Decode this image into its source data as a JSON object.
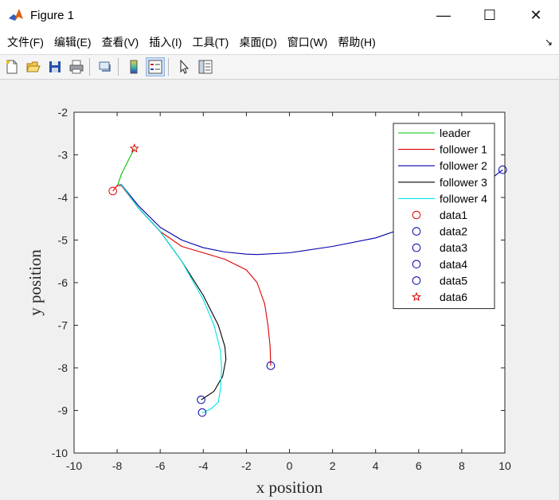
{
  "window": {
    "title": "Figure 1",
    "controls": {
      "minimize": "—",
      "maximize": "☐",
      "close": "✕"
    }
  },
  "menu": {
    "items": [
      "文件(F)",
      "编辑(E)",
      "查看(V)",
      "插入(I)",
      "工具(T)",
      "桌面(D)",
      "窗口(W)",
      "帮助(H)"
    ],
    "more_icon": "↘"
  },
  "toolbar": {
    "buttons": [
      "new-figure-icon",
      "open-file-icon",
      "save-icon",
      "print-icon",
      "link-plot-icon",
      "colorbar-icon",
      "legend-icon",
      "pointer-icon",
      "property-inspector-icon"
    ]
  },
  "chart_data": {
    "type": "line",
    "title": "",
    "xlabel": "x position",
    "ylabel": "y position",
    "xlim": [
      -10,
      10
    ],
    "ylim": [
      -10,
      -2
    ],
    "xticks": [
      -10,
      -8,
      -6,
      -4,
      -2,
      0,
      2,
      4,
      6,
      8,
      10
    ],
    "yticks": [
      -2,
      -3,
      -4,
      -5,
      -6,
      -7,
      -8,
      -9,
      -10
    ],
    "legend_position": "top-right",
    "grid": false,
    "series": [
      {
        "name": "leader",
        "kind": "line",
        "color": "#00c000",
        "x": [
          -7.2,
          -7.5,
          -7.8,
          -8.0
        ],
        "y": [
          -2.85,
          -3.15,
          -3.45,
          -3.75
        ]
      },
      {
        "name": "follower 1",
        "kind": "line",
        "color": "#dd0000",
        "x": [
          -8.2,
          -8.0,
          -7.8,
          -7.0,
          -6.0,
          -5.0,
          -4.0,
          -3.0,
          -2.0,
          -1.5,
          -1.15,
          -1.0,
          -0.9,
          -0.88,
          -0.87
        ],
        "y": [
          -3.85,
          -3.72,
          -3.72,
          -4.25,
          -4.8,
          -5.15,
          -5.3,
          -5.45,
          -5.7,
          -6.0,
          -6.5,
          -7.0,
          -7.5,
          -7.8,
          -7.95
        ]
      },
      {
        "name": "follower 2",
        "kind": "line",
        "color": "#0000aa",
        "x": [
          -7.9,
          -7.8,
          -7.0,
          -6.0,
          -5.0,
          -4.0,
          -3.0,
          -2.0,
          -1.5,
          0.0,
          2.0,
          4.0,
          6.0,
          8.0,
          9.9
        ],
        "y": [
          -3.7,
          -3.7,
          -4.2,
          -4.7,
          -5.0,
          -5.18,
          -5.28,
          -5.33,
          -5.34,
          -5.3,
          -5.15,
          -4.95,
          -4.6,
          -4.1,
          -3.35
        ]
      },
      {
        "name": "follower 3",
        "kind": "line",
        "color": "#000000",
        "x": [
          -7.9,
          -7.8,
          -7.0,
          -6.0,
          -5.0,
          -4.0,
          -3.3,
          -3.0,
          -2.95,
          -3.1,
          -3.5,
          -4.0,
          -4.1
        ],
        "y": [
          -3.7,
          -3.7,
          -4.25,
          -4.8,
          -5.5,
          -6.3,
          -7.0,
          -7.5,
          -7.8,
          -8.2,
          -8.55,
          -8.72,
          -8.75
        ]
      },
      {
        "name": "follower 4",
        "kind": "line",
        "color": "#00e5e5",
        "x": [
          -7.9,
          -7.8,
          -7.0,
          -6.0,
          -5.0,
          -4.0,
          -3.5,
          -3.2,
          -3.15,
          -3.2,
          -3.3,
          -3.6,
          -4.0,
          -4.05
        ],
        "y": [
          -3.7,
          -3.7,
          -4.25,
          -4.8,
          -5.5,
          -6.4,
          -7.0,
          -7.6,
          -8.0,
          -8.5,
          -8.8,
          -8.95,
          -9.05,
          -9.05
        ]
      },
      {
        "name": "data1",
        "kind": "marker",
        "marker": "circle",
        "color": "#dd0000",
        "x": [
          -8.2
        ],
        "y": [
          -3.85
        ]
      },
      {
        "name": "data2",
        "kind": "marker",
        "marker": "circle",
        "color": "#0000aa",
        "x": [
          -0.87
        ],
        "y": [
          -7.95
        ]
      },
      {
        "name": "data3",
        "kind": "marker",
        "marker": "circle",
        "color": "#0000aa",
        "x": [
          9.9
        ],
        "y": [
          -3.35
        ]
      },
      {
        "name": "data4",
        "kind": "marker",
        "marker": "circle",
        "color": "#0000aa",
        "x": [
          -4.1
        ],
        "y": [
          -8.75
        ]
      },
      {
        "name": "data5",
        "kind": "marker",
        "marker": "circle",
        "color": "#0000aa",
        "x": [
          -4.05
        ],
        "y": [
          -9.05
        ]
      },
      {
        "name": "data6",
        "kind": "marker",
        "marker": "star",
        "color": "#dd0000",
        "x": [
          -7.2
        ],
        "y": [
          -2.85
        ]
      }
    ]
  }
}
